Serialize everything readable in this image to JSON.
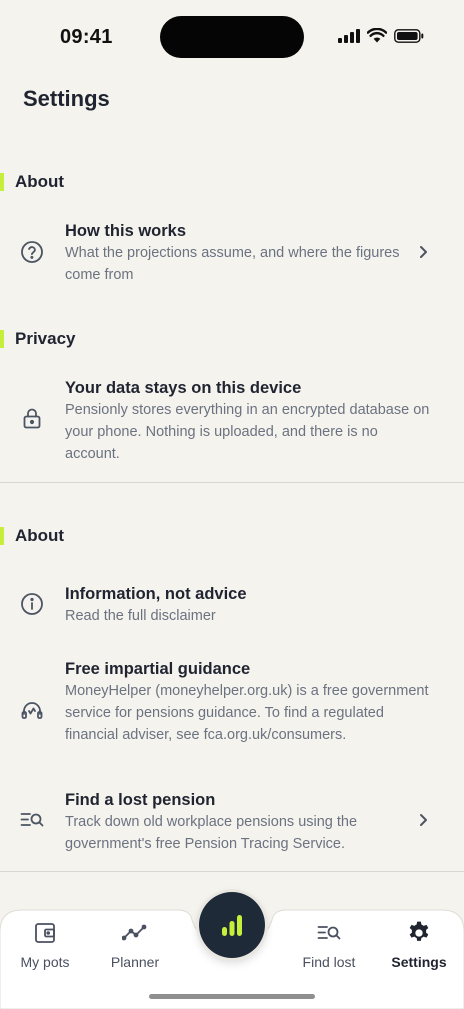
{
  "status_bar": {
    "time": "09:41"
  },
  "header": {
    "title": "Settings"
  },
  "sections": {
    "about_1": {
      "label": "About"
    },
    "privacy": {
      "label": "Privacy"
    },
    "about_2": {
      "label": "About"
    }
  },
  "rows": {
    "how_this_works": {
      "title": "How this works",
      "subtitle": "What the projections assume, and where the figures come from",
      "icon": "help-circle-icon"
    },
    "data_on_device": {
      "title": "Your data stays on this device",
      "subtitle": "Pensionly stores everything in an encrypted database on your phone. Nothing is uploaded, and there is no account.",
      "icon": "lock-icon"
    },
    "not_advice": {
      "title": "Information, not advice",
      "subtitle": "Read the full disclaimer",
      "icon": "info-icon"
    },
    "guidance": {
      "title": "Free impartial guidance",
      "subtitle": "MoneyHelper (moneyhelper.org.uk) is a free government service for pensions guidance. To find a regulated financial adviser, see fca.org.uk/consumers.",
      "icon": "headset-icon"
    },
    "lost_pension": {
      "title": "Find a lost pension",
      "subtitle": "Track down old workplace pensions using the government's free Pension Tracing Service.",
      "icon": "search-list-icon"
    }
  },
  "tabs": {
    "my_pots": {
      "label": "My pots",
      "icon": "wallet-icon"
    },
    "planner": {
      "label": "Planner",
      "icon": "trend-line-icon"
    },
    "find_lost": {
      "label": "Find lost",
      "icon": "search-list-icon"
    },
    "settings": {
      "label": "Settings",
      "icon": "gear-icon"
    }
  },
  "center_action": {
    "icon": "bar-chart-icon"
  },
  "colors": {
    "accent": "#c6ef3c",
    "fab": "#1f2a38",
    "background": "#f5f3ee"
  }
}
